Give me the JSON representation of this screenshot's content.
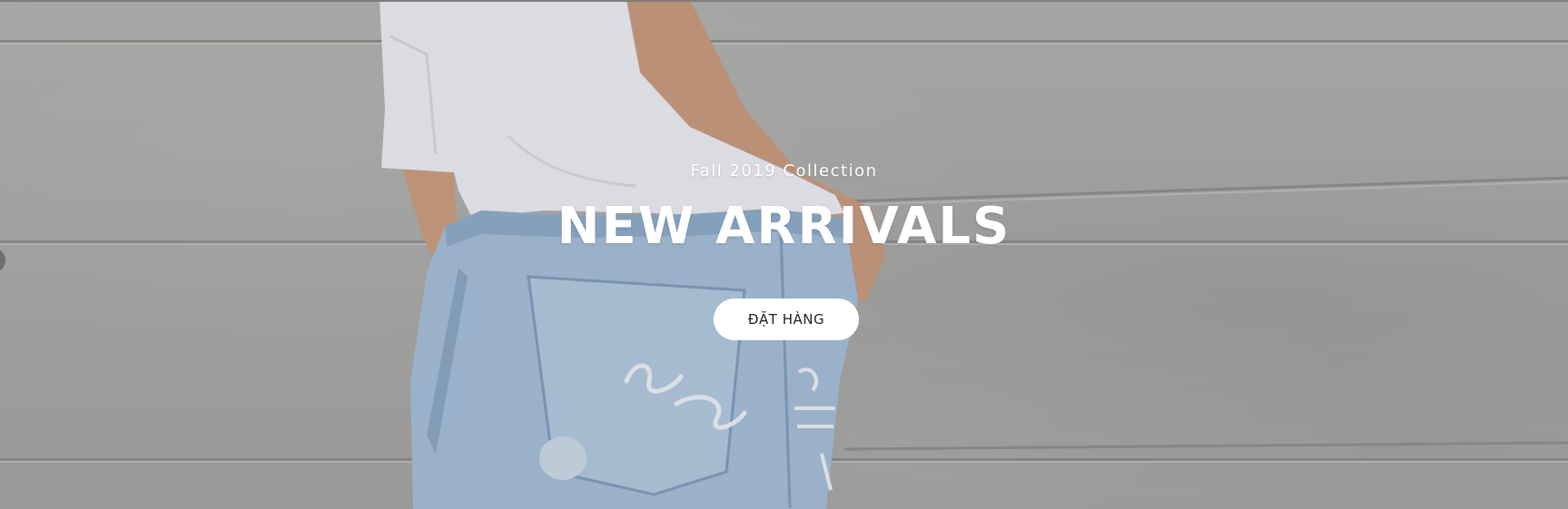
{
  "hero": {
    "subtitle": "Fall 2019 Collection",
    "title": "NEW ARRIVALS",
    "cta_label": "ĐẶT HÀNG"
  },
  "colors": {
    "wall": "#a9a9a7",
    "shirt": "#e8e8f0",
    "denim": "#9fb8d2",
    "skin": "#c99a7c",
    "text": "#ffffff",
    "button_bg": "#ffffff",
    "button_text": "#222222"
  }
}
